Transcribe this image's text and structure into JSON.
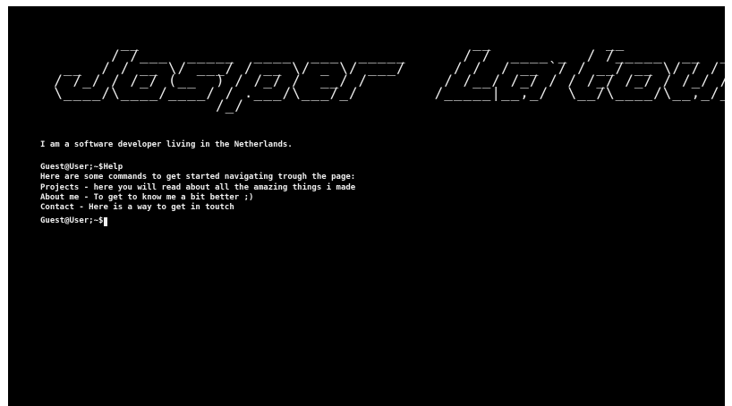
{
  "terminal": {
    "ascii_banner": "         __                                   __            __            \n        / /___  _____  ____  ___  _____      / /  ____ _  / /_____  __  _______\n   __  / / __ \\/ ___/ / __ \\/ _ \\/ ___/     / /  / __ `/ / __/ __ \\/ / / / ___/\n  / /_/ / /_/ (__  ) / /_/ /  __/ /        / /__/ /_/ / / /_/ /_/ / /_/ / /    \n  \\____/\\____/____/ / .___/\\___/_/        /_____|__,_/  \\__/\\____/\\__,_/_/     \n                   /_/                                                          ",
    "intro": "I am a software developer living in the Netherlands.",
    "history": [
      {
        "text": "Guest@User;~$Help"
      },
      {
        "text": "Here are some commands to get started navigating trough the page:"
      },
      {
        "text": "Projects - here you will read about all the amazing things i made"
      },
      {
        "text": "About me - To get to know me a bit better ;)"
      },
      {
        "text": "Contact - Here is a way to get in toutch"
      }
    ],
    "prompt": "Guest@User;~$",
    "input_value": ""
  },
  "colors": {
    "background": "#000000",
    "text": "#f0f0f0"
  }
}
